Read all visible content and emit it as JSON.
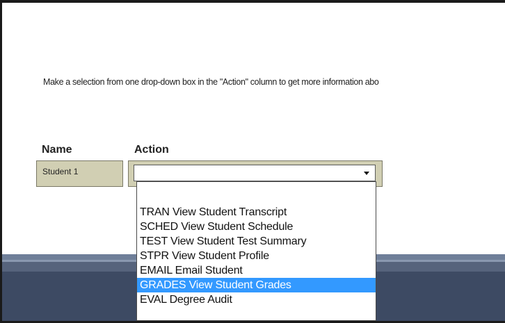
{
  "page": {
    "instructions": "Make a selection from one drop-down box in the \"Action\" column to get more information abo"
  },
  "table": {
    "headers": {
      "name": "Name",
      "action": "Action"
    },
    "rows": [
      {
        "name": "Student 1",
        "action_value": ""
      }
    ]
  },
  "dropdown": {
    "options": [
      "TRAN View Student Transcript",
      "SCHED View Student Schedule",
      "TEST View Student Test Summary",
      "STPR View Student Profile",
      "EMAIL Email Student",
      "GRADES View Student Grades",
      "EVAL Degree Audit"
    ],
    "highlighted": "GRADES View Student Grades"
  },
  "colors": {
    "cell_bg": "#d1cfb3",
    "highlight": "#3399ff",
    "footer": "#3d4a63"
  },
  "icons": {
    "select_arrow": "chevron-down-icon"
  }
}
